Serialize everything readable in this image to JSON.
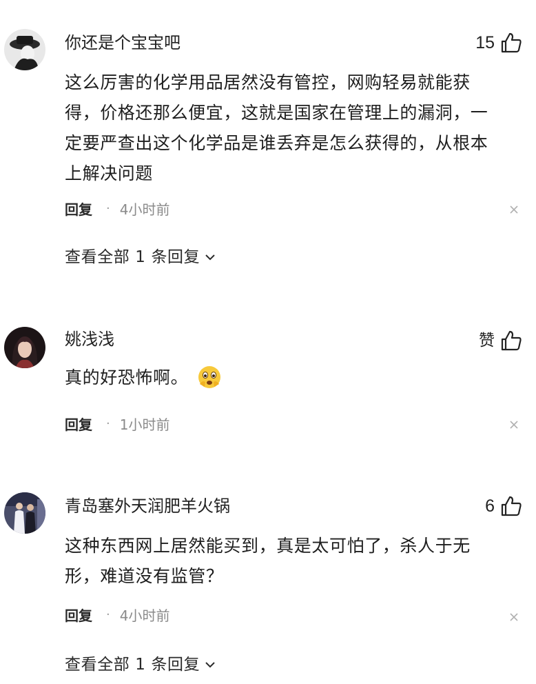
{
  "comments": [
    {
      "username": "你还是个宝宝吧",
      "like_count": "15",
      "text_lines": [
        "这么厉害的化学用品居然没有管控，网购轻易就能获",
        "得，价格还那么便宜，这就是国家在管理上的漏洞，一",
        "定要严查出这个化学品是谁丢弃是怎么获得的，从根本",
        "上解决问题"
      ],
      "reply_label": "回复",
      "separator": "·",
      "time": "4小时前",
      "view_replies": "查看全部 1 条回复"
    },
    {
      "username": "姚浅浅",
      "like_label": "赞",
      "text": "真的好恐怖啊。",
      "emoji": "scared-face-emoji",
      "reply_label": "回复",
      "separator": "·",
      "time": "1小时前"
    },
    {
      "username": "青岛塞外天润肥羊火锅",
      "like_count": "6",
      "text_lines": [
        "这种东西网上居然能买到，真是太可怕了，杀人于无",
        "形，难道没有监管？"
      ],
      "reply_label": "回复",
      "separator": "·",
      "time": "4小时前",
      "view_replies": "查看全部 1 条回复"
    }
  ],
  "icons": {
    "like": "thumb-up-icon",
    "close": "close-icon",
    "expand": "chevron-down-icon"
  },
  "colors": {
    "text": "#1e1e1e",
    "meta": "#8a8a8a",
    "emoji": "#f5c518"
  }
}
